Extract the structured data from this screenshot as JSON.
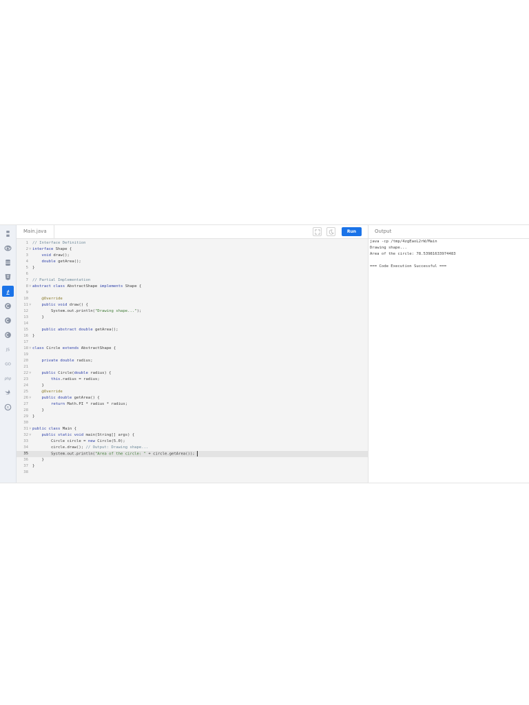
{
  "sidebar": {
    "items": [
      {
        "name": "python-icon",
        "active": false
      },
      {
        "name": "r-icon",
        "active": false
      },
      {
        "name": "database-icon",
        "active": false
      },
      {
        "name": "html5-icon",
        "active": false
      },
      {
        "name": "java-icon",
        "active": true
      },
      {
        "name": "c-icon",
        "active": false
      },
      {
        "name": "cpp-icon",
        "active": false
      },
      {
        "name": "csharp-icon",
        "active": false
      },
      {
        "name": "javascript-icon",
        "active": false,
        "label": "JS"
      },
      {
        "name": "go-icon",
        "active": false,
        "label": "GO"
      },
      {
        "name": "php-icon",
        "active": false,
        "label": "php"
      },
      {
        "name": "swift-icon",
        "active": false
      },
      {
        "name": "rust-icon",
        "active": false
      }
    ]
  },
  "editor": {
    "file_tab": "Main.java",
    "run_label": "Run",
    "current_line": 35,
    "lines": [
      {
        "n": "1",
        "fold": "",
        "tokens": [
          {
            "t": "// Interface Definition",
            "c": "c"
          }
        ]
      },
      {
        "n": "2",
        "fold": "-",
        "tokens": [
          {
            "t": "interface",
            "c": "k"
          },
          {
            "t": " Shape {",
            "c": ""
          }
        ]
      },
      {
        "n": "3",
        "fold": "",
        "tokens": [
          {
            "t": "    ",
            "c": ""
          },
          {
            "t": "void",
            "c": "k"
          },
          {
            "t": " draw();",
            "c": ""
          }
        ]
      },
      {
        "n": "4",
        "fold": "",
        "tokens": [
          {
            "t": "    ",
            "c": ""
          },
          {
            "t": "double",
            "c": "k"
          },
          {
            "t": " getArea();",
            "c": ""
          }
        ]
      },
      {
        "n": "5",
        "fold": "",
        "tokens": [
          {
            "t": "}",
            "c": ""
          }
        ]
      },
      {
        "n": "6",
        "fold": "",
        "tokens": []
      },
      {
        "n": "7",
        "fold": "",
        "tokens": [
          {
            "t": "// Partial Implementation",
            "c": "c"
          }
        ]
      },
      {
        "n": "8",
        "fold": "-",
        "tokens": [
          {
            "t": "abstract class",
            "c": "k"
          },
          {
            "t": " AbstractShape ",
            "c": ""
          },
          {
            "t": "implements",
            "c": "k"
          },
          {
            "t": " Shape {",
            "c": ""
          }
        ]
      },
      {
        "n": "9",
        "fold": "",
        "tokens": []
      },
      {
        "n": "10",
        "fold": "",
        "tokens": [
          {
            "t": "    ",
            "c": ""
          },
          {
            "t": "@Override",
            "c": "a"
          }
        ]
      },
      {
        "n": "11",
        "fold": "-",
        "tokens": [
          {
            "t": "    ",
            "c": ""
          },
          {
            "t": "public void",
            "c": "k"
          },
          {
            "t": " draw() {",
            "c": ""
          }
        ]
      },
      {
        "n": "12",
        "fold": "",
        "tokens": [
          {
            "t": "        System.out.println(",
            "c": ""
          },
          {
            "t": "\"Drawing shape...\"",
            "c": "s"
          },
          {
            "t": ");",
            "c": ""
          }
        ]
      },
      {
        "n": "13",
        "fold": "",
        "tokens": [
          {
            "t": "    }",
            "c": ""
          }
        ]
      },
      {
        "n": "14",
        "fold": "",
        "tokens": []
      },
      {
        "n": "15",
        "fold": "",
        "tokens": [
          {
            "t": "    ",
            "c": ""
          },
          {
            "t": "public abstract double",
            "c": "k"
          },
          {
            "t": " getArea();",
            "c": ""
          }
        ]
      },
      {
        "n": "16",
        "fold": "",
        "tokens": [
          {
            "t": "}",
            "c": ""
          }
        ]
      },
      {
        "n": "17",
        "fold": "",
        "tokens": []
      },
      {
        "n": "18",
        "fold": "-",
        "tokens": [
          {
            "t": "class",
            "c": "k"
          },
          {
            "t": " Circle ",
            "c": ""
          },
          {
            "t": "extends",
            "c": "k"
          },
          {
            "t": " AbstractShape {",
            "c": ""
          }
        ]
      },
      {
        "n": "19",
        "fold": "",
        "tokens": []
      },
      {
        "n": "20",
        "fold": "",
        "tokens": [
          {
            "t": "    ",
            "c": ""
          },
          {
            "t": "private double",
            "c": "k"
          },
          {
            "t": " radius;",
            "c": ""
          }
        ]
      },
      {
        "n": "21",
        "fold": "",
        "tokens": []
      },
      {
        "n": "22",
        "fold": "-",
        "tokens": [
          {
            "t": "    ",
            "c": ""
          },
          {
            "t": "public",
            "c": "k"
          },
          {
            "t": " Circle(",
            "c": ""
          },
          {
            "t": "double",
            "c": "k"
          },
          {
            "t": " radius) {",
            "c": ""
          }
        ]
      },
      {
        "n": "23",
        "fold": "",
        "tokens": [
          {
            "t": "        ",
            "c": ""
          },
          {
            "t": "this",
            "c": "k"
          },
          {
            "t": ".radius = radius;",
            "c": ""
          }
        ]
      },
      {
        "n": "24",
        "fold": "",
        "tokens": [
          {
            "t": "    }",
            "c": ""
          }
        ]
      },
      {
        "n": "25",
        "fold": "",
        "tokens": [
          {
            "t": "    ",
            "c": ""
          },
          {
            "t": "@Override",
            "c": "a"
          }
        ]
      },
      {
        "n": "26",
        "fold": "-",
        "tokens": [
          {
            "t": "    ",
            "c": ""
          },
          {
            "t": "public double",
            "c": "k"
          },
          {
            "t": " getArea() {",
            "c": ""
          }
        ]
      },
      {
        "n": "27",
        "fold": "",
        "tokens": [
          {
            "t": "        ",
            "c": ""
          },
          {
            "t": "return",
            "c": "k"
          },
          {
            "t": " Math.PI * radius * radius;",
            "c": ""
          }
        ]
      },
      {
        "n": "28",
        "fold": "",
        "tokens": [
          {
            "t": "    }",
            "c": ""
          }
        ]
      },
      {
        "n": "29",
        "fold": "",
        "tokens": [
          {
            "t": "}",
            "c": ""
          }
        ]
      },
      {
        "n": "30",
        "fold": "",
        "tokens": []
      },
      {
        "n": "31",
        "fold": "-",
        "tokens": [
          {
            "t": "public class",
            "c": "k"
          },
          {
            "t": " Main {",
            "c": ""
          }
        ]
      },
      {
        "n": "32",
        "fold": "-",
        "tokens": [
          {
            "t": "    ",
            "c": ""
          },
          {
            "t": "public static void",
            "c": "k"
          },
          {
            "t": " main(String[] args) {",
            "c": ""
          }
        ]
      },
      {
        "n": "33",
        "fold": "",
        "tokens": [
          {
            "t": "        Circle circle = ",
            "c": ""
          },
          {
            "t": "new",
            "c": "k"
          },
          {
            "t": " Circle(5.0);",
            "c": ""
          }
        ]
      },
      {
        "n": "34",
        "fold": "",
        "tokens": [
          {
            "t": "        circle.draw(); ",
            "c": ""
          },
          {
            "t": "// Output: Drawing shape...",
            "c": "c"
          }
        ]
      },
      {
        "n": "35",
        "fold": "",
        "tokens": [
          {
            "t": "        System.out.println(",
            "c": ""
          },
          {
            "t": "\"Area of the circle: \"",
            "c": "s"
          },
          {
            "t": " + circle.getArea());",
            "c": ""
          }
        ]
      },
      {
        "n": "36",
        "fold": "",
        "tokens": [
          {
            "t": "    }",
            "c": ""
          }
        ]
      },
      {
        "n": "37",
        "fold": "",
        "tokens": [
          {
            "t": "}",
            "c": ""
          }
        ]
      },
      {
        "n": "38",
        "fold": "",
        "tokens": []
      }
    ]
  },
  "output": {
    "title": "Output",
    "lines": [
      "java -cp /tmp/4zgEaoL2rW/Main",
      "Drawing shape...",
      "Area of the circle: 78.53981633974483",
      "",
      "=== Code Execution Successful ==="
    ]
  },
  "colors": {
    "accent": "#1a73e8",
    "keyword": "#2b3ea8",
    "comment": "#6f8a9a",
    "string": "#3f7a35"
  }
}
